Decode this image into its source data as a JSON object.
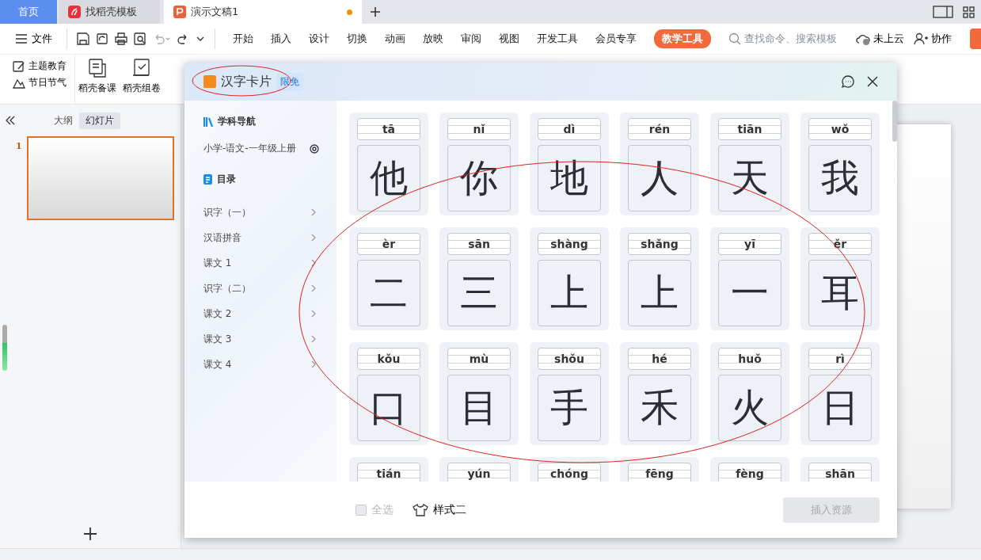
{
  "tabs": [
    {
      "label": "首页",
      "kind": "home",
      "selected": false,
      "unsaved": false
    },
    {
      "label": "找稻壳模板",
      "kind": "template",
      "selected": false,
      "unsaved": false
    },
    {
      "label": "演示文稿1",
      "kind": "document",
      "selected": true,
      "unsaved": true
    }
  ],
  "menu": {
    "file": "文件",
    "items": [
      {
        "label": "开始",
        "selected": false
      },
      {
        "label": "插入",
        "selected": false
      },
      {
        "label": "设计",
        "selected": false
      },
      {
        "label": "切换",
        "selected": false
      },
      {
        "label": "动画",
        "selected": false
      },
      {
        "label": "放映",
        "selected": false
      },
      {
        "label": "审阅",
        "selected": false
      },
      {
        "label": "视图",
        "selected": false
      },
      {
        "label": "开发工具",
        "selected": false
      },
      {
        "label": "会员专享",
        "selected": false
      },
      {
        "label": "教学工具",
        "selected": true
      }
    ],
    "search": {
      "placeholder": "查找命令、搜索模板"
    },
    "cloud": "未上云",
    "share": "协作"
  },
  "ribbon": {
    "small": [
      {
        "label": "主题教育",
        "kind": "theme"
      },
      {
        "label": "节日节气",
        "kind": "festival"
      }
    ],
    "large": [
      {
        "label": "稻壳备课",
        "kind": "lesson"
      },
      {
        "label": "稻壳组卷",
        "kind": "paper"
      }
    ]
  },
  "panel": {
    "tabs": [
      {
        "label": "大纲",
        "selected": false
      },
      {
        "label": "幻灯片",
        "selected": true
      }
    ],
    "slides": [
      {
        "number": "1",
        "selected": true
      }
    ]
  },
  "dialog": {
    "title": "汉字卡片",
    "badge": "限免",
    "nav": {
      "heading": "学科导航",
      "subject": "小学-语文-一年级上册",
      "toc": "目录",
      "items": [
        {
          "label": "识字（一）"
        },
        {
          "label": "汉语拼音"
        },
        {
          "label": "课文 1"
        },
        {
          "label": "识字（二）"
        },
        {
          "label": "课文 2"
        },
        {
          "label": "课文 3"
        },
        {
          "label": "课文 4"
        }
      ]
    },
    "cards": [
      {
        "pinyin": "tā",
        "character": "他"
      },
      {
        "pinyin": "nǐ",
        "character": "你"
      },
      {
        "pinyin": "dì",
        "character": "地"
      },
      {
        "pinyin": "rén",
        "character": "人"
      },
      {
        "pinyin": "tiān",
        "character": "天"
      },
      {
        "pinyin": "wǒ",
        "character": "我"
      },
      {
        "pinyin": "èr",
        "character": "二"
      },
      {
        "pinyin": "sān",
        "character": "三"
      },
      {
        "pinyin": "shàng",
        "character": "上"
      },
      {
        "pinyin": "shǎng",
        "character": "上"
      },
      {
        "pinyin": "yī",
        "character": "一"
      },
      {
        "pinyin": "ěr",
        "character": "耳"
      },
      {
        "pinyin": "kǒu",
        "character": "口"
      },
      {
        "pinyin": "mù",
        "character": "目"
      },
      {
        "pinyin": "shǒu",
        "character": "手"
      },
      {
        "pinyin": "hé",
        "character": "禾"
      },
      {
        "pinyin": "huǒ",
        "character": "火"
      },
      {
        "pinyin": "rì",
        "character": "日"
      },
      {
        "pinyin": "tián"
      },
      {
        "pinyin": "yún"
      },
      {
        "pinyin": "chóng"
      },
      {
        "pinyin": "fēng"
      },
      {
        "pinyin": "fèng"
      },
      {
        "pinyin": "shān"
      }
    ],
    "select_all": {
      "label": "全选",
      "checked": false,
      "disabled": true
    },
    "style": "样式二",
    "insert": {
      "label": "插入资源",
      "disabled": true
    }
  }
}
